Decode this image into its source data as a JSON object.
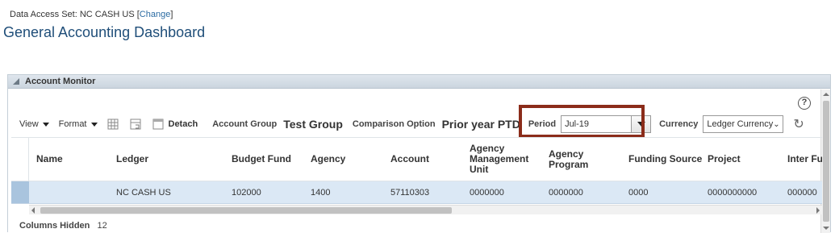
{
  "data_access": {
    "label": "Data Access Set:",
    "value": "NC CASH US",
    "change_prefix": "[",
    "change_link": "Change",
    "change_suffix": "]"
  },
  "page_title": "General Accounting Dashboard",
  "panel": {
    "title": "Account Monitor"
  },
  "toolbar": {
    "view_label": "View",
    "format_label": "Format",
    "detach_label": "Detach",
    "account_group_label": "Account Group",
    "account_group_value": "Test Group",
    "comparison_label": "Comparison Option",
    "comparison_value": "Prior year PTD",
    "period_label": "Period",
    "period_value": "Jul-19",
    "currency_label": "Currency",
    "currency_value": "Ledger Currency",
    "help": "?"
  },
  "table": {
    "columns": [
      "Name",
      "Ledger",
      "Budget Fund",
      "Agency",
      "Account",
      "Agency Management Unit",
      "Agency Program",
      "Funding Source",
      "Project",
      "Inter Fu"
    ],
    "rows": [
      [
        "",
        "NC CASH US",
        "102000",
        "1400",
        "57110303",
        "0000000",
        "0000000",
        "0000",
        "0000000000",
        "000000"
      ]
    ]
  },
  "footer": {
    "columns_hidden_label": "Columns Hidden",
    "columns_hidden_value": "12"
  },
  "colors": {
    "title": "#1f4e79",
    "highlight_box": "#8b2c1a",
    "selected_row": "#dbe8f5"
  }
}
